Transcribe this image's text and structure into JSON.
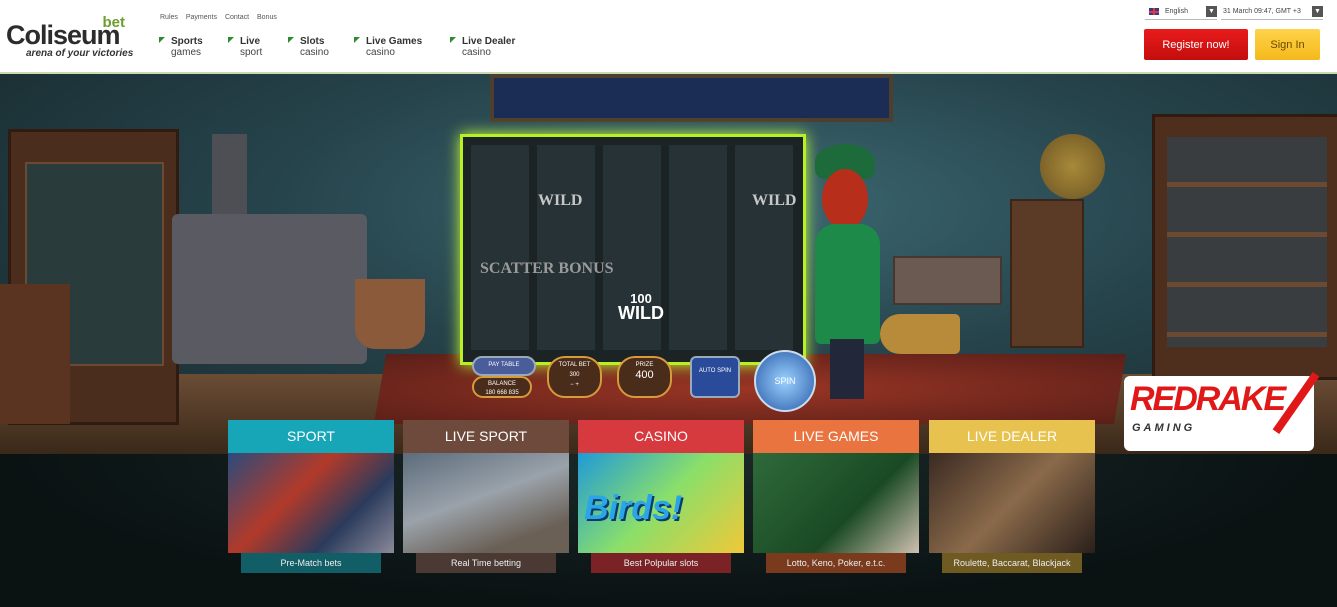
{
  "header": {
    "logo": {
      "bet": "bet",
      "name": "Coliseum",
      "tagline": "arena of your victories"
    },
    "top_links": [
      "Rules",
      "Payments",
      "Contact",
      "Bonus"
    ],
    "nav": [
      {
        "main": "Sports",
        "sub": "games"
      },
      {
        "main": "Live",
        "sub": "sport"
      },
      {
        "main": "Slots",
        "sub": "casino"
      },
      {
        "main": "Live Games",
        "sub": "casino"
      },
      {
        "main": "Live Dealer",
        "sub": "casino"
      }
    ],
    "language": "English",
    "datetime": "31 March 09:47, GMT +3",
    "register_label": "Register now!",
    "signin_label": "Sign In"
  },
  "hero": {
    "wild_text": "WILD",
    "scatter_text": "SCATTER BONUS",
    "big_wild_value": "100",
    "big_wild_label": "WILD",
    "controls": {
      "paytable": "PAY TABLE",
      "balance_label": "BALANCE",
      "balance_value": "180 668 835",
      "total_bet_label": "TOTAL BET",
      "total_bet_value": "300",
      "prize_label": "PRIZE",
      "prize_value": "400",
      "auto_spin": "AUTO SPIN",
      "spin": "SPIN"
    },
    "provider_logo": {
      "name": "REDRAKE",
      "sub": "GAMING"
    }
  },
  "tiles": [
    {
      "title": "SPORT",
      "caption": "Pre-Match bets"
    },
    {
      "title": "LIVE SPORT",
      "caption": "Real Time betting"
    },
    {
      "title": "CASINO",
      "caption": "Best Polpular slots",
      "art_text": "Birds!"
    },
    {
      "title": "LIVE GAMES",
      "caption": "Lotto, Keno, Poker, e.t.c."
    },
    {
      "title": "LIVE DEALER",
      "caption": "Roulette, Baccarat, Blackjack"
    }
  ],
  "colors": {
    "register": "#e81b1b",
    "signin": "#f4b91b",
    "sport": "#17a5b8",
    "live_sport": "#6d4a3b",
    "casino": "#d63a3e",
    "live_games": "#e9743f",
    "live_dealer": "#e8c24e"
  }
}
